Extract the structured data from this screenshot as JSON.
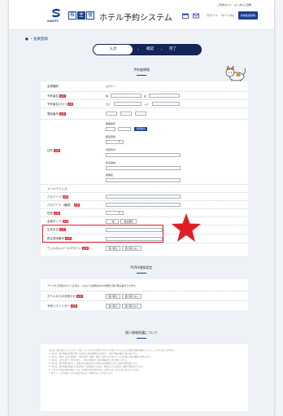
{
  "header": {
    "logo_text": "SAMTY",
    "kanji": [
      "株",
      "主",
      "優",
      "待"
    ],
    "system_title": "ホテル予約システム",
    "top_link": "ご利用ガイド・よくあるご質問",
    "login_label": "ログイン",
    "cart_label": "カート(0)",
    "register_button": "新規会員登録"
  },
  "page": {
    "title": "● ・会員登録"
  },
  "steps": [
    "入力",
    "確認",
    "完了"
  ],
  "sections": {
    "reservation": "予約者情報",
    "push": "PUSH通知設定",
    "privacy": "個人情報保護について"
  },
  "form": {
    "section_label": "会員種別",
    "section_value": "ログイン",
    "name_label": "予約者名",
    "name_kana_label": "予約者名(カナ)",
    "phone_label": "電話番号",
    "address_label": "住所",
    "mail_label": "メールアドレス",
    "password_label": "パスワード",
    "password_confirm_label": "パスワード（確認）",
    "gender_label": "性別",
    "mail_type_label": "会員タイプ",
    "birth_label": "生年月日",
    "shareholder_label": "株主優待番号",
    "magazine_label": "ウェルカムメールマガジン",
    "required": "必須",
    "last_name": "姓",
    "first_name": "名",
    "last_kana": "セイ",
    "first_kana": "メイ",
    "zip_label": "郵便番号",
    "zip_button": "住所検索",
    "pref_label": "都道府県",
    "city_label": "市区町村",
    "street_label": "町名番地",
    "building_label": "建物名",
    "gender_option_1": "男性",
    "gender_option_2": "女性",
    "type_option_1": "一般",
    "type_option_2": "株主優待",
    "yes_receive": "受け取る",
    "no_receive": "受け取らない"
  },
  "push": {
    "intro": "アプリをご利用されている方は、このような通知をPUSH通知で受け取る事ができます。",
    "row1_label": "ホテルからのお知らせ",
    "row2_label": "予約リマインダー",
    "receive": "受け取る",
    "not_receive": "受け取らない"
  },
  "privacy": {
    "lines": [
      "当社は、株式会社サムティ(以下「当社」といいます)の提供するホテル予約システムにおける個人情報の取扱いについて、以下のとおり定めます。",
      "1. 当社は、個人情報の保護に関する法律その他の関係法令を遵守し、個人情報を適正に取り扱います。",
      "2. 当社は、取得した個人情報を、予約の受付・確認・変更・取消しその他のサービス提供に必要な範囲で利用します。",
      "3. 当社は、法令に基づく場合を除き、ご本人の同意なく個人情報を第三者に提供しません。",
      "4. 当社は、個人情報の漏えい、滅失又はき損の防止その他の安全管理のために必要な措置を講じます。",
      "5. 当社は、個人情報の取扱いの全部又は一部を委託する場合、委託先に対し必要かつ適切な監督を行います。",
      "6. ご本人から個人情報の開示・訂正・利用停止等の請求があった場合には、法令に従い対応いたします。",
      "7. 本ポリシーの内容は、法令の改正等に応じて変更することがあります。"
    ]
  },
  "colors": {
    "brand": "#1c3f94",
    "step_bar": "#14255a",
    "required": "#d8262e",
    "highlight": "#e01e28"
  }
}
